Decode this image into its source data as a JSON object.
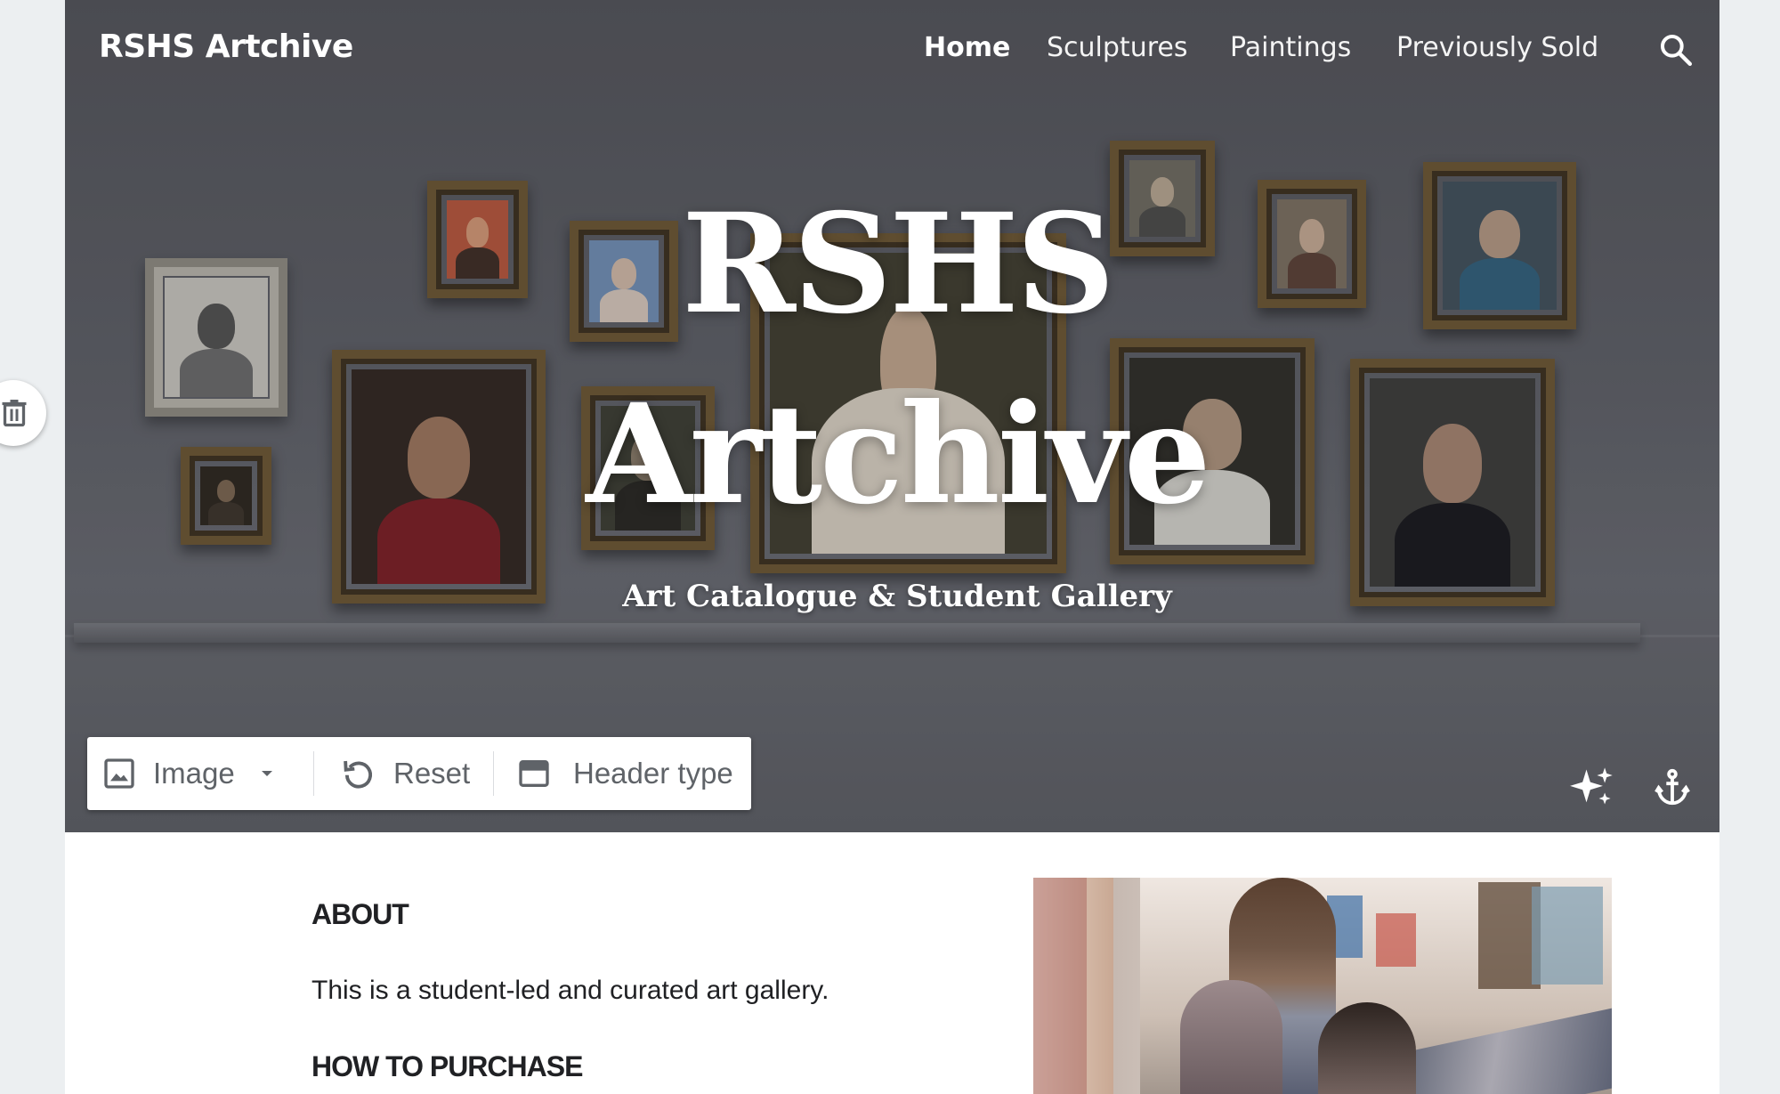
{
  "site": {
    "title": "RSHS Artchive"
  },
  "nav": {
    "items": [
      {
        "label": "Home",
        "active": true
      },
      {
        "label": "Sculptures",
        "active": false
      },
      {
        "label": "Paintings",
        "active": false
      },
      {
        "label": "Previously Sold",
        "active": false
      }
    ],
    "search_icon": "search-icon"
  },
  "hero": {
    "title_line1": "RSHS",
    "title_line2": "Artchive",
    "subtitle": "Art Catalogue & Student Gallery"
  },
  "toolbar": {
    "image_label": "Image",
    "reset_label": "Reset",
    "header_type_label": "Header type",
    "icons": [
      "image-icon",
      "dropdown-arrow-icon",
      "reset-icon",
      "header-type-icon"
    ]
  },
  "hero_actions": {
    "icons": [
      "sparkle-icon",
      "anchor-icon"
    ]
  },
  "side_actions": {
    "icons": [
      "trash-icon"
    ]
  },
  "content": {
    "about_heading": "ABOUT",
    "about_text": "This is a student-led and curated art gallery.",
    "purchase_heading": "HOW TO PURCHASE"
  },
  "colors": {
    "hero_overlay": "#55575d",
    "toolbar_bg": "#ffffff",
    "toolbar_text": "#5f6368",
    "heading_text": "#202124"
  }
}
